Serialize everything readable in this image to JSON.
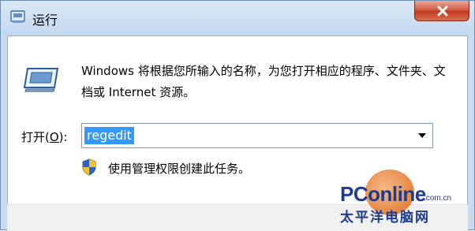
{
  "window": {
    "title": "运行",
    "title_icon": "run-icon",
    "close_icon": "close-icon"
  },
  "dialog": {
    "description": "Windows 将根据您所输入的名称，为您打开相应的程序、文件夹、文档或 Internet 资源。",
    "open_label_prefix": "打开(",
    "open_label_accel": "O",
    "open_label_suffix": "):",
    "input_value": "regedit",
    "admin_note": "使用管理权限创建此任务。",
    "shield_icon": "uac-shield-icon"
  },
  "watermark": {
    "brand": "PConline",
    "domain": ".com.cn",
    "subtitle": "太平洋电脑网"
  },
  "colors": {
    "selection": "#3399ff",
    "frame": "#c9dcef",
    "close": "#c0391f",
    "watermark": "#1d3c8f"
  }
}
